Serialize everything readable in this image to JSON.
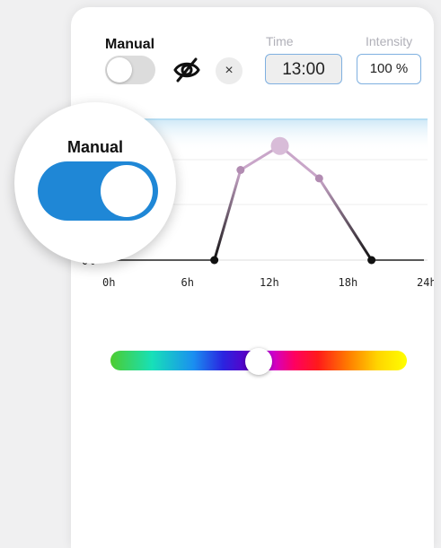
{
  "header": {
    "manual_label": "Manual",
    "manual_on": false
  },
  "controls": {
    "eye_icon": "eye-off-icon",
    "close_icon": "close-icon",
    "close_glyph": "×"
  },
  "time": {
    "label": "Time",
    "value": "13:00"
  },
  "intensity": {
    "label": "Intensity",
    "value": "100 %"
  },
  "chart_data": {
    "type": "line",
    "y_label_visible": "0%",
    "x_tick_labels": [
      "0h",
      "6h",
      "12h",
      "18h",
      "24h"
    ],
    "xlim": [
      0,
      24
    ],
    "ylim": [
      0,
      100
    ],
    "x": [
      0,
      8,
      10,
      13,
      16,
      20,
      24
    ],
    "y": [
      0,
      0,
      75,
      95,
      68,
      0,
      0
    ],
    "highlight_x": 13
  },
  "color_slider": {
    "position": 0.5
  },
  "magnifier": {
    "label": "Manual",
    "toggle_on": true
  },
  "colors": {
    "accent": "#1f87d6",
    "line_light": "#c9a6c9"
  }
}
